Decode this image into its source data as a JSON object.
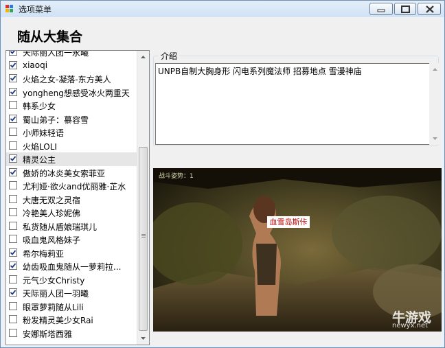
{
  "window": {
    "title": "选项菜单"
  },
  "header": {
    "title": "随从大集合"
  },
  "list": {
    "items": [
      {
        "label": "天际丽人团一永曦",
        "checked": true
      },
      {
        "label": "xiaoqi",
        "checked": true
      },
      {
        "label": "火焰之女-凝落-东方美人",
        "checked": true
      },
      {
        "label": "yongheng想感受冰火两重天",
        "checked": true
      },
      {
        "label": "韩系少女",
        "checked": false
      },
      {
        "label": "蜀山弟子：慕容雪",
        "checked": true
      },
      {
        "label": "小师妹轻语",
        "checked": false
      },
      {
        "label": "火焰LOLI",
        "checked": false
      },
      {
        "label": "精灵公主",
        "checked": true,
        "highlight": true
      },
      {
        "label": "傲娇的冰炎美女索菲亚",
        "checked": true
      },
      {
        "label": "尤利娅·欲火and优丽雅·芷水",
        "checked": false
      },
      {
        "label": "大唐无双之灵宿",
        "checked": false
      },
      {
        "label": "冷艳美人珍妮佛",
        "checked": false
      },
      {
        "label": "私货随从盾娘瑞琪儿",
        "checked": false
      },
      {
        "label": "吸血鬼风格妹子",
        "checked": false
      },
      {
        "label": "希尔梅莉亚",
        "checked": true
      },
      {
        "label": "幼齿吸血鬼随从一萝莉拉...",
        "checked": true
      },
      {
        "label": "元气少女Christy",
        "checked": false
      },
      {
        "label": "天际丽人团一羽曦",
        "checked": true
      },
      {
        "label": "眼罩萝莉随从Lili",
        "checked": false
      },
      {
        "label": "粉发精灵美少女Rai",
        "checked": false
      },
      {
        "label": "安娜斯塔西雅",
        "checked": false
      }
    ]
  },
  "intro": {
    "legend": "介绍",
    "text": "UNPB自制大胸身形  闪电系列魔法师 招募地点 雪漫神庙"
  },
  "image": {
    "caption": "战斗姿势：1",
    "sign_text": "血雪岛斯佧",
    "watermark_text": "牛游戏",
    "watermark_url": "newyx.net"
  }
}
